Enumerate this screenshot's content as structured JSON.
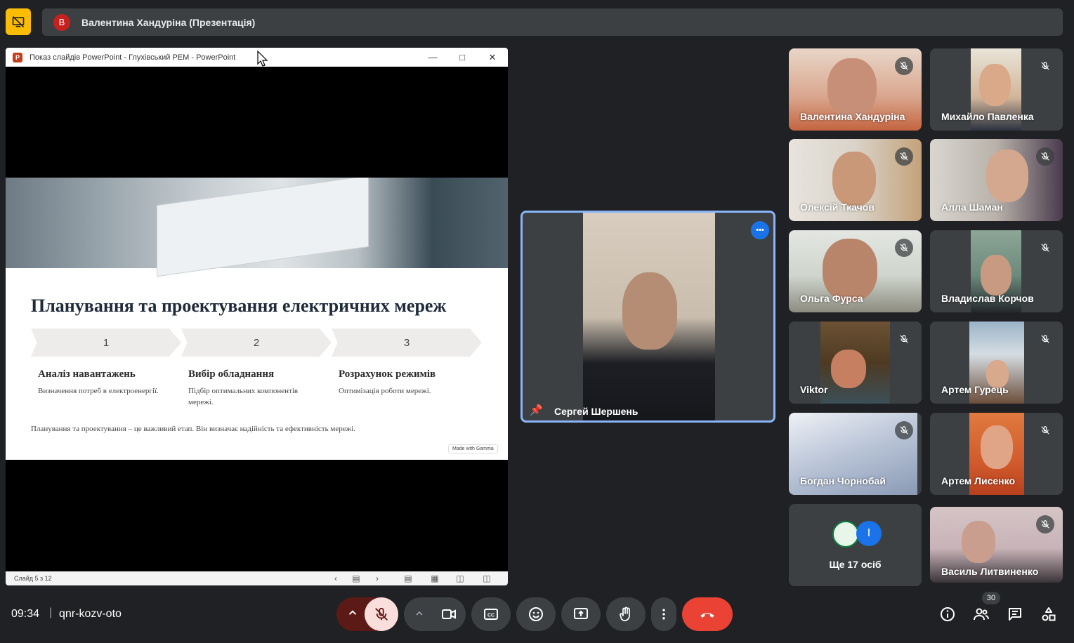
{
  "presenter": {
    "avatar_letter": "В",
    "label": "Валентина Хандуріна (Презентація)"
  },
  "ppt": {
    "window_title": "Показ слайдів PowerPoint  -  Глухівський РЕМ - PowerPoint",
    "logo_letter": "P",
    "slide_counter": "Слайд 5 з 12",
    "slide": {
      "heading": "Планування та проектування електричних мереж",
      "steps": [
        {
          "num": "1",
          "title": "Аналіз навантажень",
          "desc": "Визначення потреб в електроенергії."
        },
        {
          "num": "2",
          "title": "Вибір обладнання",
          "desc": "Підбір оптимальних компонентів мережі."
        },
        {
          "num": "3",
          "title": "Розрахунок режимів",
          "desc": "Оптимізація роботи мережі."
        }
      ],
      "footer": "Планування та проектування – це важливий етап. Він визначає надійність та ефективність мережі.",
      "badge": "Made with Gamma"
    }
  },
  "speaker": {
    "name": "Сергей Шершень"
  },
  "participants": [
    {
      "name": "Валентина Хандуріна"
    },
    {
      "name": "Михайло Павленка"
    },
    {
      "name": "Олексій Ткачов"
    },
    {
      "name": "Алла Шаман"
    },
    {
      "name": "Ольга Фурса"
    },
    {
      "name": "Владислав Корчов"
    },
    {
      "name": "Viktor"
    },
    {
      "name": "Артем Гурець"
    },
    {
      "name": "Богдан Чорнобай"
    },
    {
      "name": "Артем Лисенко"
    },
    {
      "name": "Василь Литвиненко"
    }
  ],
  "more": {
    "label": "Ще 17 осіб",
    "avatar_letter": "I"
  },
  "footer": {
    "clock": "09:34",
    "separator": "|",
    "meeting_code": "qnr-kozv-oto",
    "people_count": "30"
  },
  "colors": {
    "accent": "#8ab4f8",
    "present_toggle": "#fbbc04",
    "end_call": "#ea4335",
    "mic_off": "#f9dedc"
  }
}
